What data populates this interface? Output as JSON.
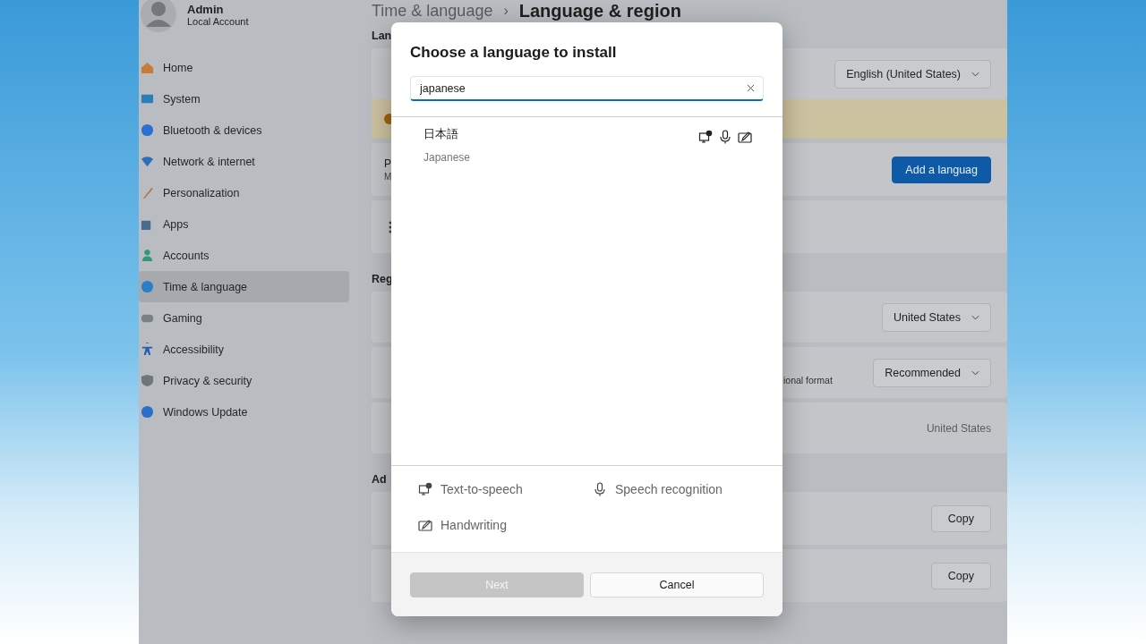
{
  "account": {
    "name": "Admin",
    "type": "Local Account"
  },
  "nav": [
    {
      "kind": "home",
      "label": "Home",
      "selected": false
    },
    {
      "kind": "system",
      "label": "System",
      "selected": false
    },
    {
      "kind": "bluetooth",
      "label": "Bluetooth & devices",
      "selected": false
    },
    {
      "kind": "network",
      "label": "Network & internet",
      "selected": false
    },
    {
      "kind": "brush",
      "label": "Personalization",
      "selected": false
    },
    {
      "kind": "apps",
      "label": "Apps",
      "selected": false
    },
    {
      "kind": "accounts",
      "label": "Accounts",
      "selected": false
    },
    {
      "kind": "time",
      "label": "Time & language",
      "selected": true
    },
    {
      "kind": "gaming",
      "label": "Gaming",
      "selected": false
    },
    {
      "kind": "accessibility",
      "label": "Accessibility",
      "selected": false
    },
    {
      "kind": "shield",
      "label": "Privacy & security",
      "selected": false
    },
    {
      "kind": "update",
      "label": "Windows Update",
      "selected": false
    }
  ],
  "breadcrumb": {
    "parent": "Time & language",
    "separator": "›",
    "current": "Language & region"
  },
  "sections": [
    {
      "heading": "Lan",
      "cards": [
        {
          "kind": "dropdown",
          "value": "English (United States)"
        },
        {
          "kind": "banner"
        },
        {
          "kind": "button",
          "title": "P",
          "subtitle": "M",
          "action": "Add a languag",
          "primary": true
        },
        {
          "kind": "more"
        }
      ]
    },
    {
      "heading": "Reg",
      "cards": [
        {
          "kind": "dropdown",
          "value": "United States"
        },
        {
          "kind": "dropdown",
          "caption": "ional format",
          "value": "Recommended"
        },
        {
          "kind": "text",
          "value": "United States"
        }
      ]
    },
    {
      "heading": "Ad",
      "cards": [
        {
          "kind": "button",
          "action": "Copy",
          "primary": false
        },
        {
          "kind": "button",
          "action": "Copy",
          "primary": false
        }
      ]
    }
  ],
  "dialog": {
    "title": "Choose a language to install",
    "search": {
      "value": "japanese"
    },
    "results": [
      {
        "native": "日本語",
        "english": "Japanese",
        "selected": false
      }
    ],
    "legend": [
      {
        "kind": "tts",
        "label": "Text-to-speech"
      },
      {
        "kind": "speech",
        "label": "Speech recognition"
      },
      {
        "kind": "handwriting",
        "label": "Handwriting"
      }
    ],
    "buttons": [
      {
        "label": "Next",
        "primary": true,
        "disabled": true
      },
      {
        "label": "Cancel",
        "primary": false,
        "disabled": false
      }
    ]
  }
}
